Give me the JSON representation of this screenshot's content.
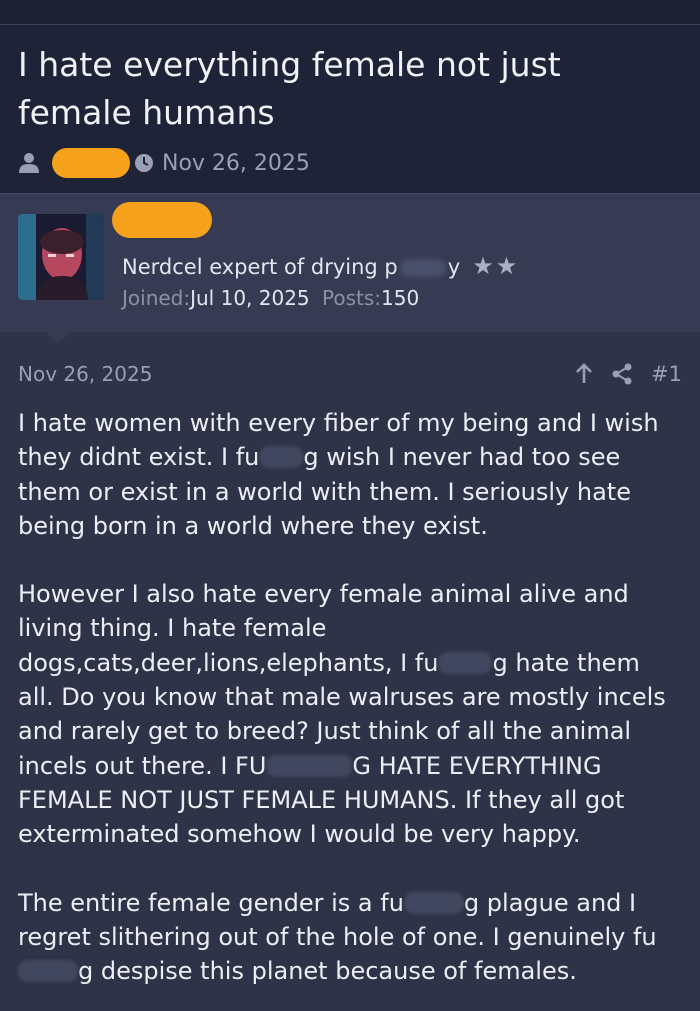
{
  "thread": {
    "title": "I hate everything female not just female humans",
    "date": "Nov 26, 2025"
  },
  "user": {
    "title_start": "Nerdcel expert of drying p",
    "title_end": "y",
    "stars": "★★",
    "joined_label": "Joined:",
    "joined_value": "Jul 10, 2025",
    "posts_label": "Posts:",
    "posts_value": "150"
  },
  "post": {
    "date": "Nov 26, 2025",
    "number": "#1",
    "p1": {
      "a": "I hate women with every fiber of my being and I wish they didnt exist. I fu",
      "b": "g wish I never had too see them or exist in a world with them. I seriously hate being born in a world where they exist."
    },
    "p2": {
      "a": "However I also hate every female animal alive and living thing. I hate female dogs,cats,deer,lions,elephants, I fu",
      "b": "g hate them all. Do you know that male walruses are mostly incels and rarely get to breed? Just think of all the animal incels out there. I FU",
      "c": "G HATE EVERYTHING FEMALE NOT JUST FEMALE HUMANS. If they all got exterminated somehow I would be very happy."
    },
    "p3": {
      "a": "The entire female gender is a fu",
      "b": "g plague and I regret slithering out of the hole of one. I genuinely fu",
      "c": "g despise this planet because of females."
    }
  },
  "colors": {
    "background": "#2e3348",
    "header": "#1e2338",
    "redaction": "#f5a11c"
  }
}
